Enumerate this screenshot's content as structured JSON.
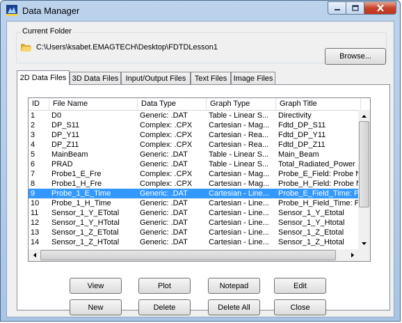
{
  "window": {
    "title": "Data Manager",
    "icon": "app-icon",
    "controls": [
      "minimize-icon",
      "maximize-icon",
      "close-icon"
    ]
  },
  "current_folder": {
    "label": "Current Folder",
    "path": "C:\\Users\\ksabet.EMAGTECH\\Desktop\\FDTDLesson1",
    "browse_label": "Browse..."
  },
  "tabs": [
    {
      "label": "2D Data Files",
      "active": true
    },
    {
      "label": "3D Data Files",
      "active": false
    },
    {
      "label": "Input/Output Files",
      "active": false
    },
    {
      "label": "Text Files",
      "active": false
    },
    {
      "label": "Image Files",
      "active": false
    }
  ],
  "table": {
    "columns": [
      "ID",
      "File Name",
      "Data Type",
      "Graph Type",
      "Graph Title"
    ],
    "rows": [
      {
        "id": "1",
        "name": "D0",
        "type": "Generic: .DAT",
        "graph": "Table - Linear S...",
        "title": "Directivity"
      },
      {
        "id": "2",
        "name": "DP_S11",
        "type": "Complex: .CPX",
        "graph": "Cartesian - Mag...",
        "title": "Fdtd_DP_S11"
      },
      {
        "id": "3",
        "name": "DP_Y11",
        "type": "Complex: .CPX",
        "graph": "Cartesian - Rea...",
        "title": "Fdtd_DP_Y11"
      },
      {
        "id": "4",
        "name": "DP_Z11",
        "type": "Complex: .CPX",
        "graph": "Cartesian - Rea...",
        "title": "Fdtd_DP_Z11"
      },
      {
        "id": "5",
        "name": "MainBeam",
        "type": "Generic: .DAT",
        "graph": "Table - Linear S...",
        "title": "Main_Beam"
      },
      {
        "id": "6",
        "name": "PRAD",
        "type": "Generic: .DAT",
        "graph": "Table - Linear S...",
        "title": "Total_Radiated_Power"
      },
      {
        "id": "7",
        "name": "Probe1_E_Fre",
        "type": "Complex: .CPX",
        "graph": "Cartesian - Mag...",
        "title": "Probe_E_Field: Probe No."
      },
      {
        "id": "8",
        "name": "Probe1_H_Fre",
        "type": "Complex: .CPX",
        "graph": "Cartesian - Mag...",
        "title": "Probe_H_Field: Probe No"
      },
      {
        "id": "9",
        "name": "Probe_1_E_Time",
        "type": "Generic: .DAT",
        "graph": "Cartesian - Line...",
        "title": "Probe_E_Field_Time: Prob",
        "selected": true
      },
      {
        "id": "10",
        "name": "Probe_1_H_Time",
        "type": "Generic: .DAT",
        "graph": "Cartesian - Line...",
        "title": "Probe_H_Field_Time: Prob"
      },
      {
        "id": "11",
        "name": "Sensor_1_Y_ETotal",
        "type": "Generic: .DAT",
        "graph": "Cartesian - Line...",
        "title": "Sensor_1_Y_Etotal"
      },
      {
        "id": "12",
        "name": "Sensor_1_Y_HTotal",
        "type": "Generic: .DAT",
        "graph": "Cartesian - Line...",
        "title": "Sensor_1_Y_Htotal"
      },
      {
        "id": "13",
        "name": "Sensor_1_Z_ETotal",
        "type": "Generic: .DAT",
        "graph": "Cartesian - Line...",
        "title": "Sensor_1_Z_Etotal"
      },
      {
        "id": "14",
        "name": "Sensor_1_Z_HTotal",
        "type": "Generic: .DAT",
        "graph": "Cartesian - Line...",
        "title": "Sensor_1_Z_Htotal"
      }
    ]
  },
  "buttons": {
    "view": "View",
    "plot": "Plot",
    "notepad": "Notepad",
    "edit": "Edit",
    "new": "New",
    "delete": "Delete",
    "delete_all": "Delete All",
    "close": "Close"
  },
  "colors": {
    "selection": "#3399ff",
    "title_bar": "#bcd3ec",
    "close_button": "#c7432b"
  }
}
